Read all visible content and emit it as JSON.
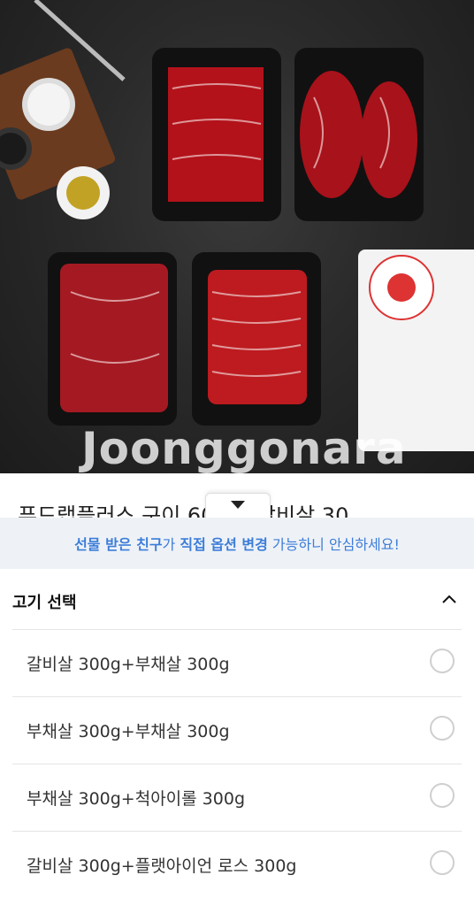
{
  "photo": {
    "watermark": "Joonggonara"
  },
  "product": {
    "title": "푸드랩플러스 구이 600g (갈비살 30"
  },
  "notice": {
    "part1": "선물 받은 친구",
    "part2": "가 ",
    "part3": "직접 옵션 변경",
    "part4": " 가능하니 안심하세요!"
  },
  "section": {
    "title": "고기 선택"
  },
  "options": [
    {
      "label": "갈비살 300g+부채살 300g"
    },
    {
      "label": "부채살 300g+부채살 300g"
    },
    {
      "label": "부채살 300g+척아이롤 300g"
    },
    {
      "label": "갈비살 300g+플랫아이언 로스 300g"
    }
  ],
  "colors": {
    "accent": "#3d7dd8",
    "notice_bg": "#eef2f7"
  }
}
